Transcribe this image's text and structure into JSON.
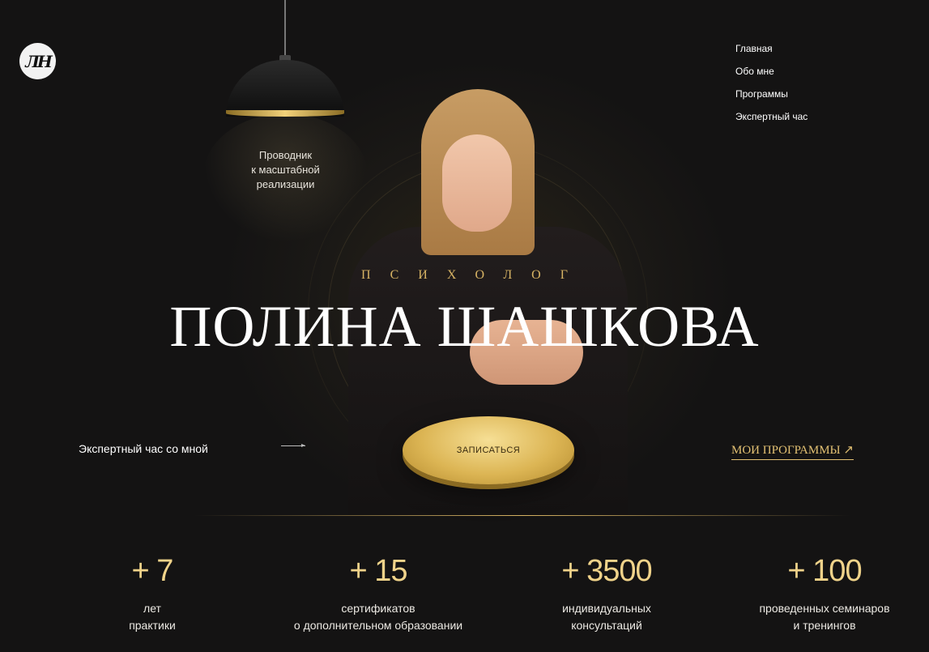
{
  "logo": {
    "text": "ЛН"
  },
  "lamp": {
    "tagline": "Проводник\nк масштабной\nреализации"
  },
  "nav": {
    "items": [
      "Главная",
      "Обо мне",
      "Программы",
      "Экспертный час"
    ]
  },
  "hero": {
    "role": "ПСИХОЛОГ",
    "name": "ПОЛИНА ШАШКОВА",
    "expert_label": "Экспертный час со мной",
    "cta_label": "ЗАПИСАТЬСЯ",
    "programs_label": "МОИ ПРОГРАММЫ ↗"
  },
  "stats": [
    {
      "value": "+ 7",
      "label": "лет\nпрактики"
    },
    {
      "value": "+ 15",
      "label": "сертификатов\nо дополнительном образовании"
    },
    {
      "value": "+ 3500",
      "label": "индивидуальных\nконсультаций"
    },
    {
      "value": "+ 100",
      "label": "проведенных семинаров\nи тренингов"
    }
  ],
  "colors": {
    "accent": "#d6b262",
    "background": "#151414"
  }
}
